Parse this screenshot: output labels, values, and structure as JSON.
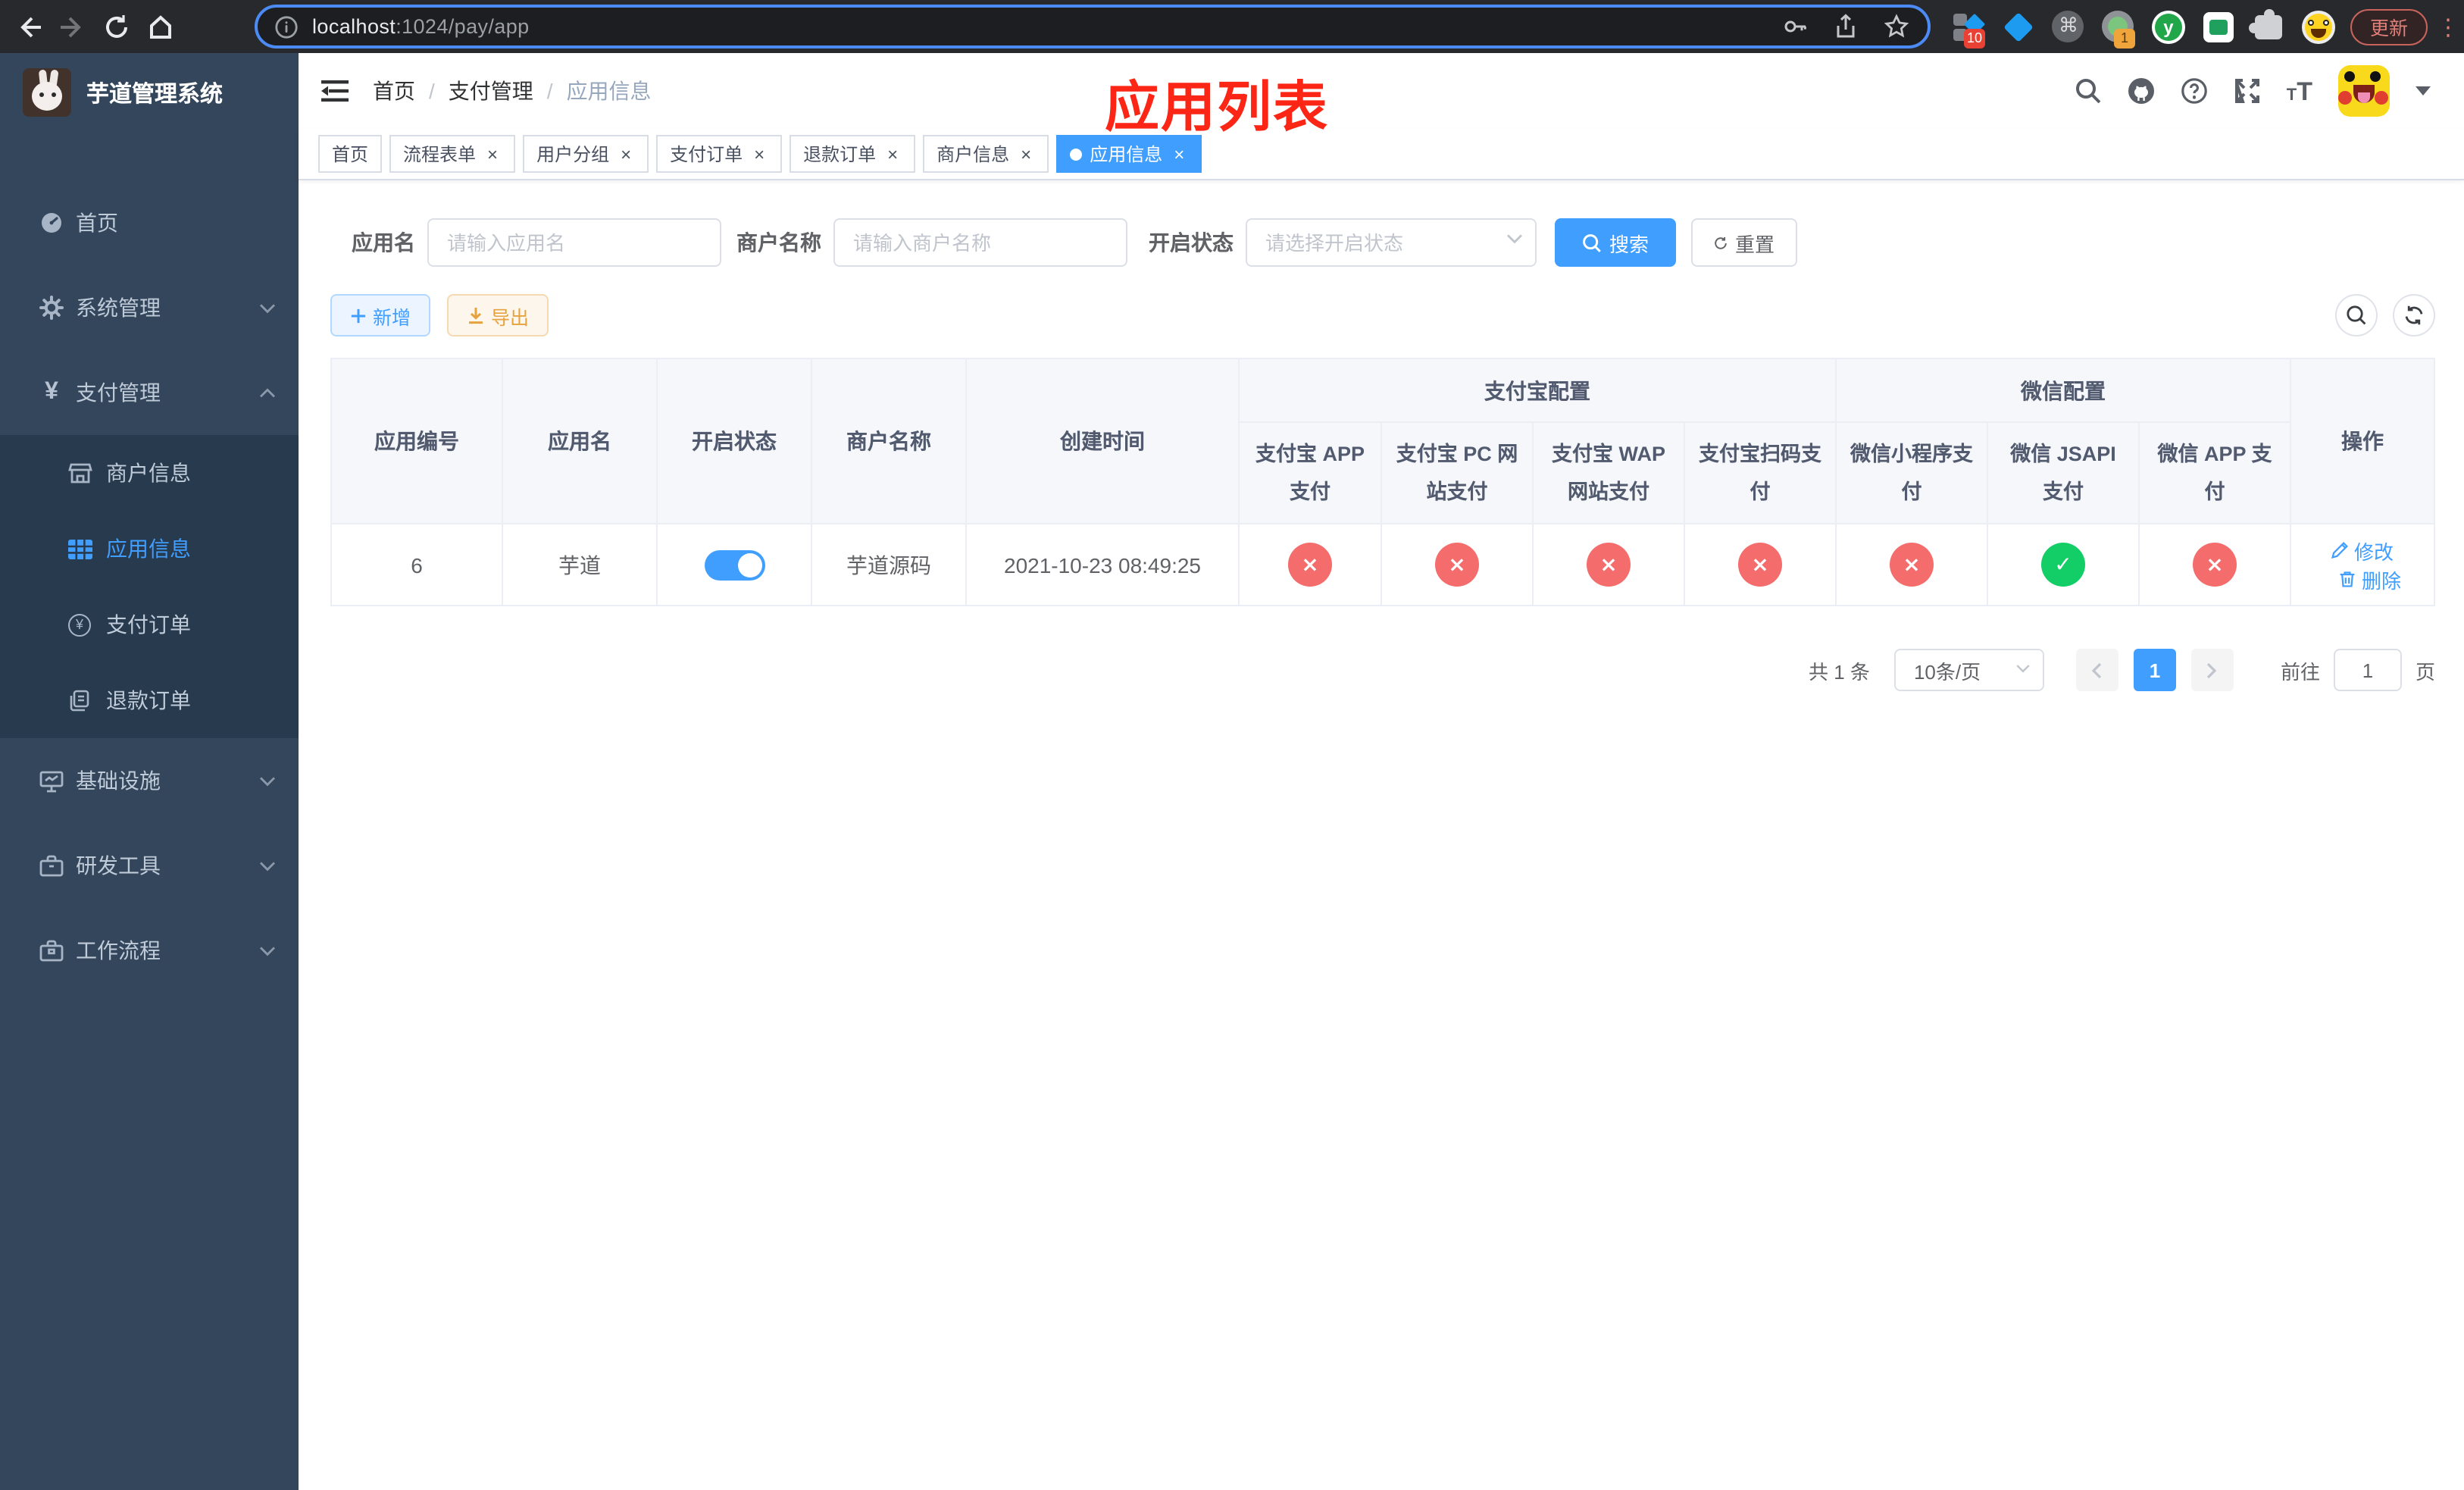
{
  "browser": {
    "url_host": "localhost",
    "url_rest": ":1024/pay/app",
    "update_label": "更新",
    "extension_badge_a": "10",
    "extension_badge_b": "1",
    "cmd_glyph": "⌘",
    "y_glyph": "y"
  },
  "annotation": {
    "title": "应用列表"
  },
  "colors": {
    "primary": "#409eff",
    "success": "#13ce66",
    "danger": "#f56c6c",
    "warning": "#e6a23c",
    "sidebar_bg": "#34465b",
    "sidebar_submenu_bg": "#283a4e",
    "annotation_red": "#fb2616"
  },
  "sidebar": {
    "title": "芋道管理系统",
    "items": [
      {
        "label": "首页"
      },
      {
        "label": "系统管理"
      },
      {
        "label": "支付管理"
      },
      {
        "label": "商户信息"
      },
      {
        "label": "应用信息"
      },
      {
        "label": "支付订单"
      },
      {
        "label": "退款订单"
      },
      {
        "label": "基础设施"
      },
      {
        "label": "研发工具"
      },
      {
        "label": "工作流程"
      }
    ]
  },
  "breadcrumb": {
    "home": "首页",
    "section": "支付管理",
    "current": "应用信息",
    "separator": "/"
  },
  "tabs": [
    {
      "label": "首页"
    },
    {
      "label": "流程表单"
    },
    {
      "label": "用户分组"
    },
    {
      "label": "支付订单"
    },
    {
      "label": "退款订单"
    },
    {
      "label": "商户信息"
    },
    {
      "label": "应用信息"
    }
  ],
  "tab_close_glyph": "×",
  "search": {
    "app_name_label": "应用名",
    "app_name_placeholder": "请输入应用名",
    "merchant_label": "商户名称",
    "merchant_placeholder": "请输入商户名称",
    "status_label": "开启状态",
    "status_placeholder": "请选择开启状态",
    "search_label": "搜索",
    "reset_label": "重置"
  },
  "toolbar": {
    "add_label": "新增",
    "export_label": "导出"
  },
  "table": {
    "columns": {
      "app_id": "应用编号",
      "app_name": "应用名",
      "status": "开启状态",
      "merchant": "商户名称",
      "created": "创建时间",
      "actions": "操作",
      "alipay_group": "支付宝配置",
      "wechat_group": "微信配置",
      "alipay_app": "支付宝 APP 支付",
      "alipay_pc": "支付宝 PC 网站支付",
      "alipay_wap": "支付宝 WAP 网站支付",
      "alipay_qr": "支付宝扫码支付",
      "wx_lite": "微信小程序支付",
      "wx_jsapi": "微信 JSAPI 支付",
      "wx_app": "微信 APP 支付"
    },
    "row": {
      "app_id": "6",
      "app_name": "芋道",
      "merchant": "芋道源码",
      "created": "2021-10-23 08:49:25",
      "statuses": [
        {
          "glyph": "×",
          "state": "fail"
        },
        {
          "glyph": "×",
          "state": "fail"
        },
        {
          "glyph": "×",
          "state": "fail"
        },
        {
          "glyph": "×",
          "state": "fail"
        },
        {
          "glyph": "×",
          "state": "fail"
        },
        {
          "glyph": "✓",
          "state": "success"
        },
        {
          "glyph": "×",
          "state": "fail"
        }
      ],
      "edit_label": "修改",
      "delete_label": "删除"
    }
  },
  "pagination": {
    "total": "共 1 条",
    "page_size": "10条/页",
    "page": "1",
    "goto_label": "前往",
    "goto_value": "1",
    "page_unit": "页"
  }
}
